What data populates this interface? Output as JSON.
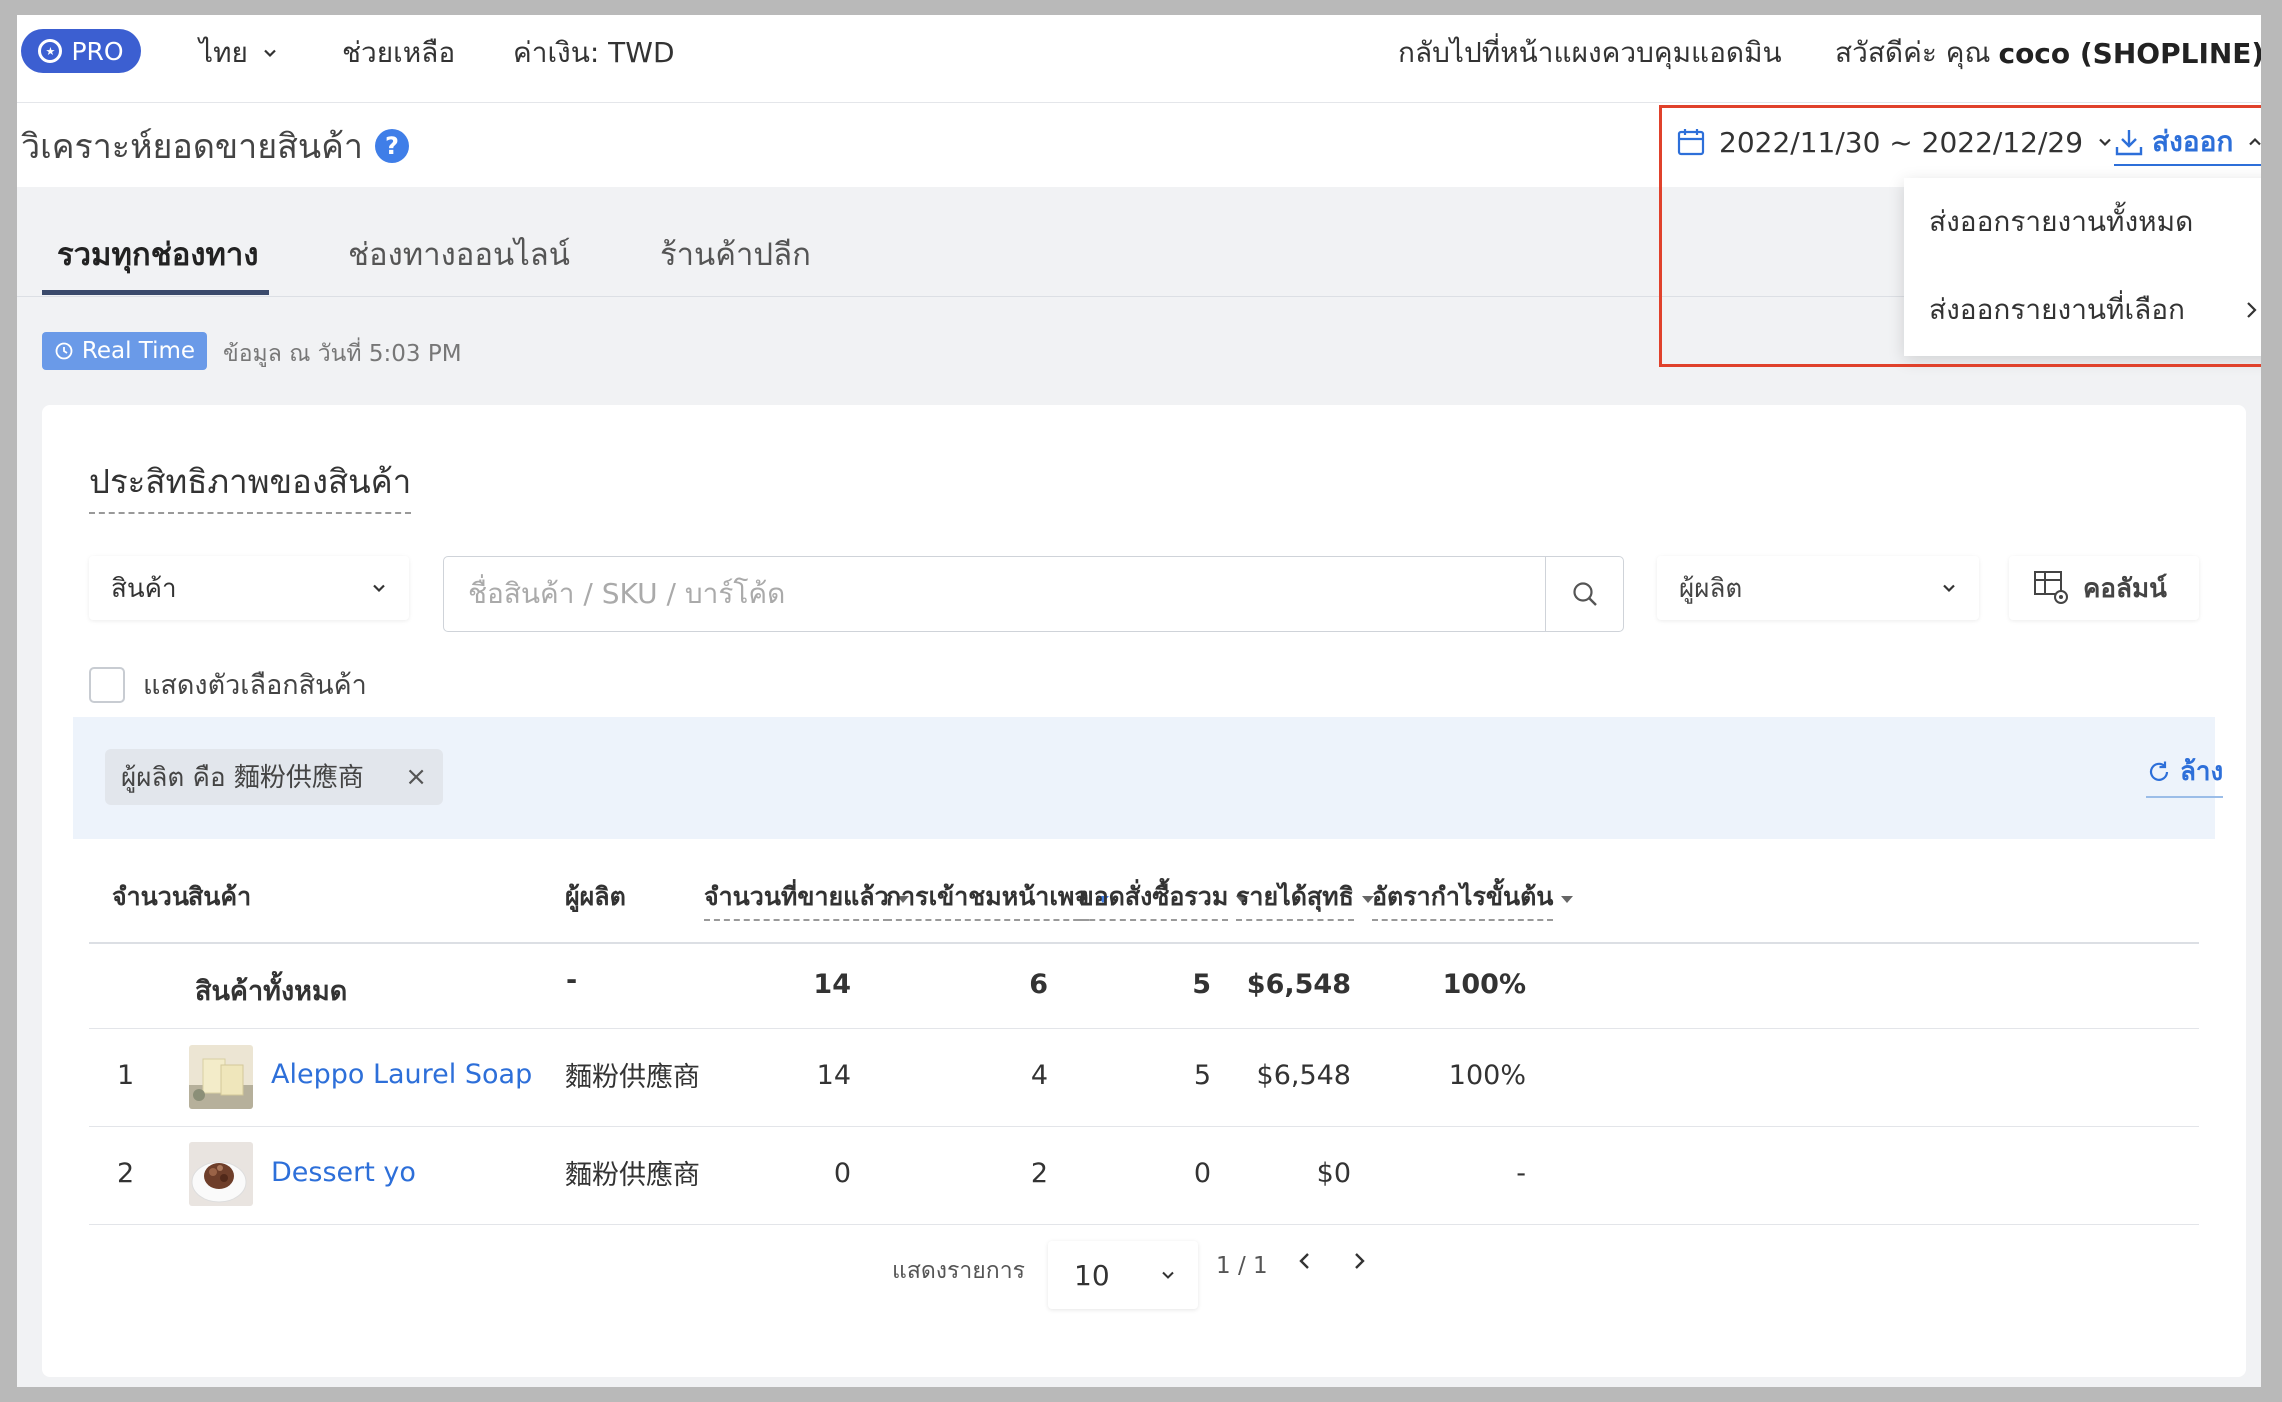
{
  "topbar": {
    "pro_label": "PRO",
    "language": "ไทย",
    "help": "ช่วยเหลือ",
    "currency": "ค่าเงิน: TWD",
    "back_admin": "กลับไปที่หน้าแผงควบคุมแอดมิน",
    "greeting_prefix": "สวัสดีค่ะ คุณ",
    "greeting_user": "coco (SHOPLINE)"
  },
  "header": {
    "title": "วิเคราะห์ยอดขายสินค้า",
    "help_glyph": "?",
    "date_range": "2022/11/30 ~ 2022/12/29",
    "export_label": "ส่งออก"
  },
  "export_menu": {
    "items": [
      {
        "label": "ส่งออกรายงานทั้งหมด"
      },
      {
        "label": "ส่งออกรายงานที่เลือก"
      }
    ]
  },
  "tabs": [
    {
      "label": "รวมทุกช่องทาง",
      "active": true
    },
    {
      "label": "ช่องทางออนไลน์",
      "active": false
    },
    {
      "label": "ร้านค้าปลีก",
      "active": false
    }
  ],
  "realtime": {
    "badge": "Real Time",
    "text": "ข้อมูล ณ วันที่ 5:03 PM"
  },
  "card": {
    "title": "ประสิทธิภาพของสินค้า",
    "product_select": "สินค้า",
    "search_placeholder": "ชื่อสินค้า / SKU / บาร์โค้ด",
    "manufacturer_select": "ผู้ผลิต",
    "columns_button": "คอลัมน์",
    "show_variants": "แสดงตัวเลือกสินค้า",
    "filter_chip": "ผู้ผลิต คือ 麵粉供應商",
    "filter_chip_remove": "×",
    "clear_label": "ล้าง"
  },
  "table": {
    "headers": {
      "index": "จำนวน",
      "product": "สินค้า",
      "manufacturer": "ผู้ผลิต",
      "qty_sold": "จำนวนที่ขายแล้ว",
      "page_views": "การเข้าชมหน้าเพจ",
      "total_orders": "ยอดสั่งซื้อรวม",
      "net_revenue": "รายได้สุทธิ",
      "gross_margin": "อัตรากำไรขั้นต้น"
    },
    "summary": {
      "product": "สินค้าทั้งหมด",
      "manufacturer": "-",
      "qty_sold": "14",
      "page_views": "6",
      "total_orders": "5",
      "net_revenue": "$6,548",
      "gross_margin": "100%"
    },
    "rows": [
      {
        "index": "1",
        "product": "Aleppo Laurel Soap",
        "manufacturer": "麵粉供應商",
        "qty_sold": "14",
        "page_views": "4",
        "total_orders": "5",
        "net_revenue": "$6,548",
        "gross_margin": "100%"
      },
      {
        "index": "2",
        "product": "Dessert yo",
        "manufacturer": "麵粉供應商",
        "qty_sold": "0",
        "page_views": "2",
        "total_orders": "0",
        "net_revenue": "$0",
        "gross_margin": "-"
      }
    ]
  },
  "pagination": {
    "label": "แสดงรายการ",
    "page_size": "10",
    "page_info": "1 / 1"
  },
  "colors": {
    "accent": "#2d6fd9",
    "pro_badge": "#3c5fd1",
    "highlight": "#e0412b",
    "realtime_badge": "#6a9ae8"
  }
}
